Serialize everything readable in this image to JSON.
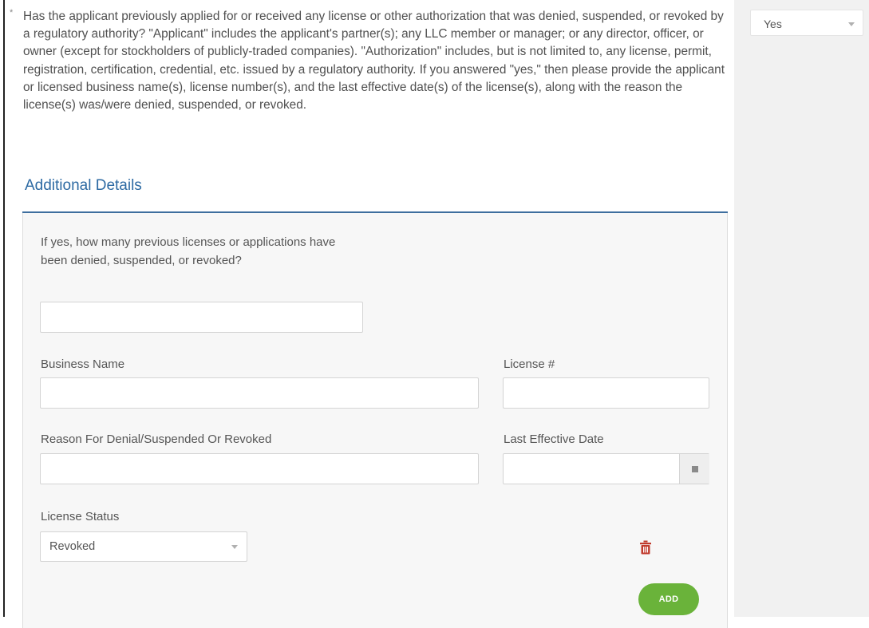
{
  "question": {
    "required_marker": "*",
    "text": "Has the applicant previously applied for or received any license or other authorization that was denied, suspended, or revoked by a regulatory authority? \"Applicant\" includes the applicant's partner(s); any LLC member or manager; or any director, officer, or owner (except for stockholders of publicly-traded companies). \"Authorization\" includes, but is not limited to, any license, permit, registration, certification, credential, etc. issued by a regulatory authority. If you answered \"yes,\" then please provide the applicant or licensed business name(s), license number(s), and the last effective date(s) of the license(s), along with the reason the license(s) was/were denied, suspended, or revoked.",
    "answer": "Yes"
  },
  "details": {
    "title": "Additional Details",
    "count_label": "If yes, how many previous licenses or applications have been denied, suspended, or revoked?",
    "count_value": "",
    "business_name_label": "Business Name",
    "business_name_value": "",
    "license_label": "License #",
    "license_value": "",
    "reason_label": "Reason For Denial/Suspended Or Revoked",
    "reason_value": "",
    "last_effective_label": "Last Effective Date",
    "last_effective_value": "",
    "status_label": "License Status",
    "status_value": "Revoked",
    "add_label": "ADD"
  },
  "colors": {
    "accent": "#2d6aa3",
    "add_button": "#6ab33a",
    "delete_icon": "#c0392b"
  },
  "icons": {
    "calendar": "calendar-icon",
    "delete": "trash-icon",
    "dropdown": "caret-down-icon"
  }
}
